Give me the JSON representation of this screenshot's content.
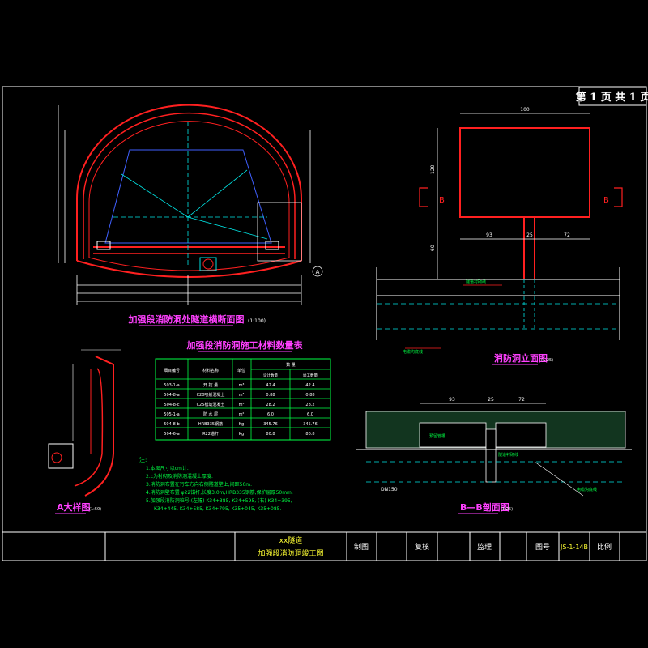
{
  "page": {
    "label": "第 1 页 共 1 页"
  },
  "title_block": {
    "project": "xx隧道",
    "drawing_title": "加强段消防洞竣工图",
    "drawn_by": "制图",
    "checked_by": "复核",
    "supervisor": "监理",
    "drawing_no_label": "图号",
    "drawing_no": "JS-1-14B",
    "scale_label": "比例"
  },
  "views": {
    "cross_section": {
      "title": "加强段消防洞处隧道横断面图",
      "scale": "(1:100)",
      "callout": "A"
    },
    "elevation": {
      "title": "消防洞立面图",
      "scale": "(1:25)",
      "section_mark": "B",
      "dims": {
        "width": "100",
        "height": "120",
        "left": "93",
        "mid": "25",
        "right": "72",
        "gap": "60"
      },
      "notes": {
        "lining": "隧道衬砌线",
        "drain": "电缆沟底线"
      }
    },
    "section_bb": {
      "title": "B—B剖面图",
      "scale": "(1:25)",
      "dims": {
        "left": "93",
        "mid": "25",
        "right": "72"
      },
      "notes": {
        "n1": "预留管槽",
        "n2": "隧道衬砌线",
        "n3": "电缆沟底线",
        "n4": "DN150"
      }
    },
    "detail_a": {
      "title": "A大样图",
      "scale": "(1:50)"
    }
  },
  "material_table": {
    "title": "加强段消防洞施工材料数量表",
    "headers": {
      "code": "细目编号",
      "name": "材料名称",
      "unit": "单位",
      "qty": "数 量",
      "design": "设计数量",
      "built": "竣工数量"
    },
    "rows": [
      {
        "code": "503-1-a",
        "name": "开 挖 量",
        "unit": "m³",
        "design": "42.4",
        "built": "42.4"
      },
      {
        "code": "504-8-a",
        "name": "C20喷射混凝土",
        "unit": "m³",
        "design": "0.88",
        "built": "0.88"
      },
      {
        "code": "504-8-c",
        "name": "C25模筑混凝土",
        "unit": "m³",
        "design": "28.2",
        "built": "28.2"
      },
      {
        "code": "505-1-a",
        "name": "防 水 层",
        "unit": "m²",
        "design": "6.0",
        "built": "6.0"
      },
      {
        "code": "504-8-b",
        "name": "HRB335钢筋",
        "unit": "Kg",
        "design": "345.76",
        "built": "345.76"
      },
      {
        "code": "504-6-a",
        "name": "R22锚杆",
        "unit": "Kg",
        "design": "80.8",
        "built": "80.8"
      }
    ]
  },
  "notes": {
    "heading": "注:",
    "items": [
      "1.本图尺寸以cm计.",
      "2.c为衬砌及消防洞混凝土厚度.",
      "3.消防洞布置在行车方向右侧隧道壁上,间距50m.",
      "4.消防洞壁布置 φ22锚杆,长度3.0m,HRB335钢筋,保护层厚50mm.",
      "5.加强段消防洞桩号:(左幅) K34+385, K34+595, (右) K34+395,",
      "K34+445, K34+585, K34+795, K35+045, K35+085."
    ]
  },
  "colors": {
    "frame": "#ffffff",
    "red": "#ff2020",
    "cyan": "#00e5e5",
    "green": "#00ff44",
    "magenta": "#ff40ff",
    "yellow": "#ffff33",
    "blue": "#4060ff"
  }
}
